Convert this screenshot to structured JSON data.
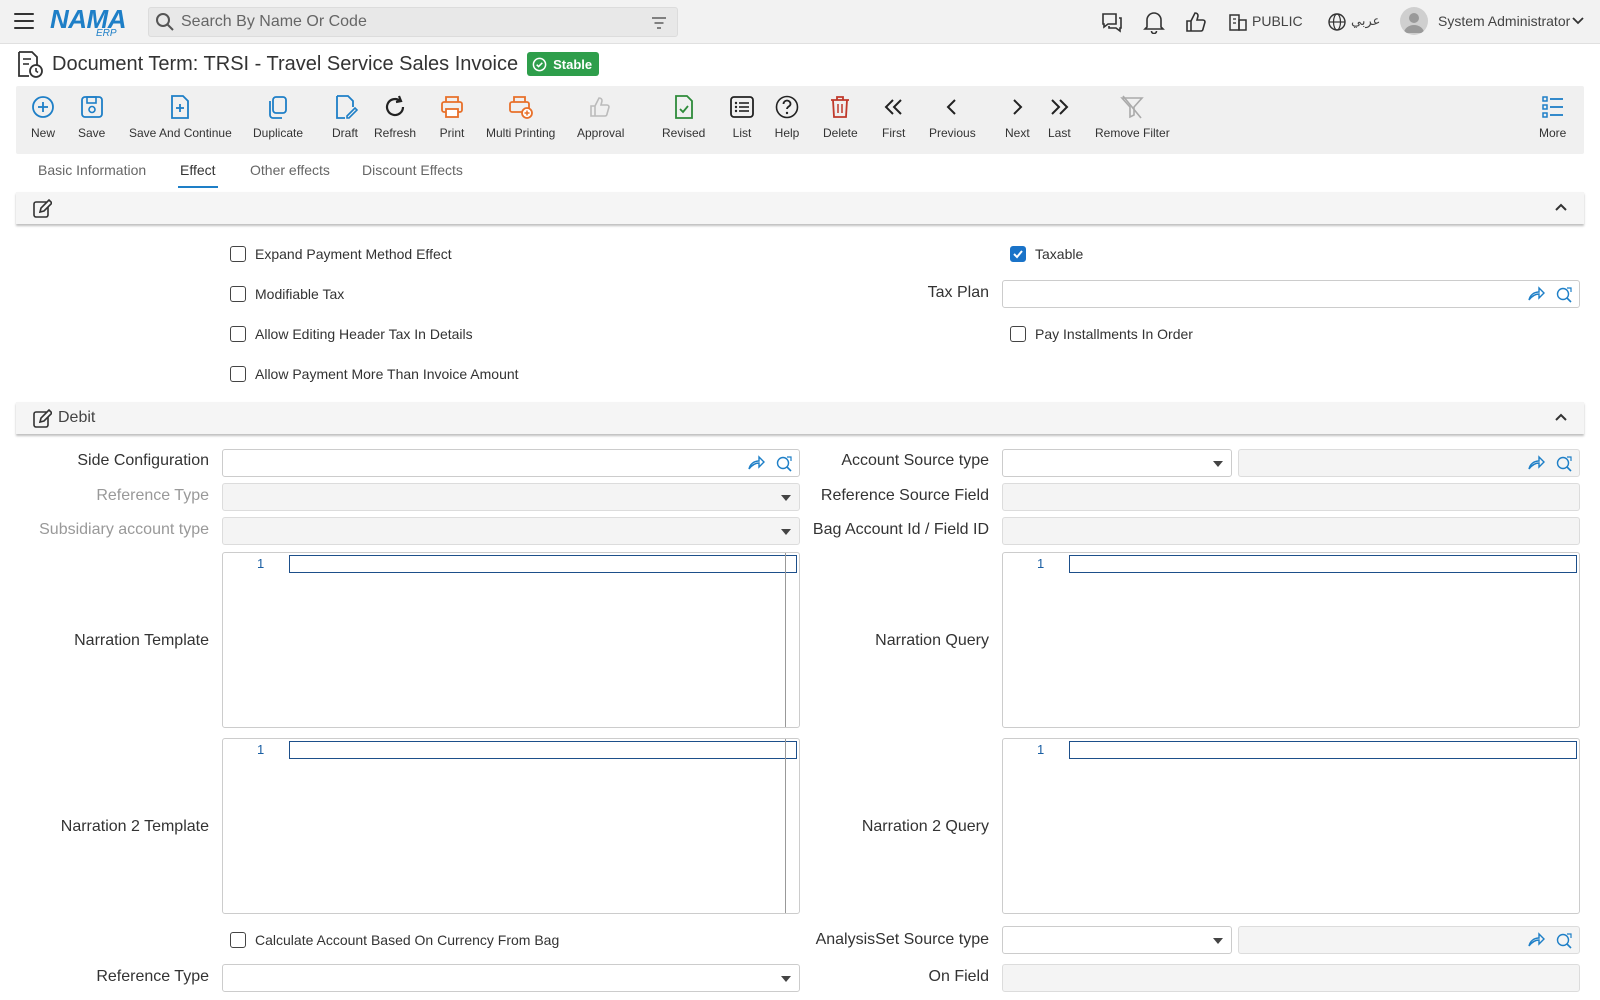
{
  "app": {
    "logo": "NAMA",
    "logo_sub": "ERP"
  },
  "search": {
    "placeholder": "Search By Name Or Code"
  },
  "topbar": {
    "branch_label": "PUBLIC",
    "language_label": "عربي",
    "user_name": "System Administrator"
  },
  "page": {
    "title": "Document Term: TRSI - Travel Service Sales Invoice",
    "status": "Stable"
  },
  "toolbar": {
    "new": "New",
    "save": "Save",
    "save_continue": "Save And Continue",
    "duplicate": "Duplicate",
    "draft": "Draft",
    "refresh": "Refresh",
    "print": "Print",
    "multi_printing": "Multi Printing",
    "approval": "Approval",
    "revised": "Revised",
    "list": "List",
    "help": "Help",
    "delete": "Delete",
    "first": "First",
    "previous": "Previous",
    "next": "Next",
    "last": "Last",
    "remove_filter": "Remove Filter",
    "more": "More"
  },
  "tabs": [
    {
      "label": "Basic Information"
    },
    {
      "label": "Effect"
    },
    {
      "label": "Other effects"
    },
    {
      "label": "Discount Effects"
    }
  ],
  "effect": {
    "expand_payment_method_effect": "Expand Payment Method Effect",
    "modifiable_tax": "Modifiable Tax",
    "allow_editing_header_tax": "Allow Editing Header Tax In Details",
    "allow_payment_more": "Allow Payment More Than Invoice Amount",
    "taxable": "Taxable",
    "taxable_checked": true,
    "tax_plan_label": "Tax Plan",
    "pay_installments_in_order": "Pay Installments In Order"
  },
  "debit": {
    "title": "Debit",
    "side_configuration": "Side Configuration",
    "reference_type": "Reference Type",
    "subsidiary_account_type": "Subsidiary account type",
    "account_source_type": "Account Source type",
    "reference_source_field": "Reference Source Field",
    "bag_account_id": "Bag Account Id / Field ID",
    "narration_template": "Narration Template",
    "narration_query": "Narration Query",
    "narration2_template": "Narration 2 Template",
    "narration2_query": "Narration 2 Query",
    "editor_line_number": "1",
    "calc_account_currency": "Calculate Account Based On Currency From Bag",
    "analysis_set_source_type": "AnalysisSet Source type",
    "reference_type_2": "Reference Type",
    "on_field": "On Field"
  },
  "colors": {
    "accent": "#1e7fc7",
    "status_green": "#2e9e4b",
    "print_orange": "#e8702a",
    "delete_red": "#c0392b",
    "revised_green": "#2e8b3a"
  }
}
